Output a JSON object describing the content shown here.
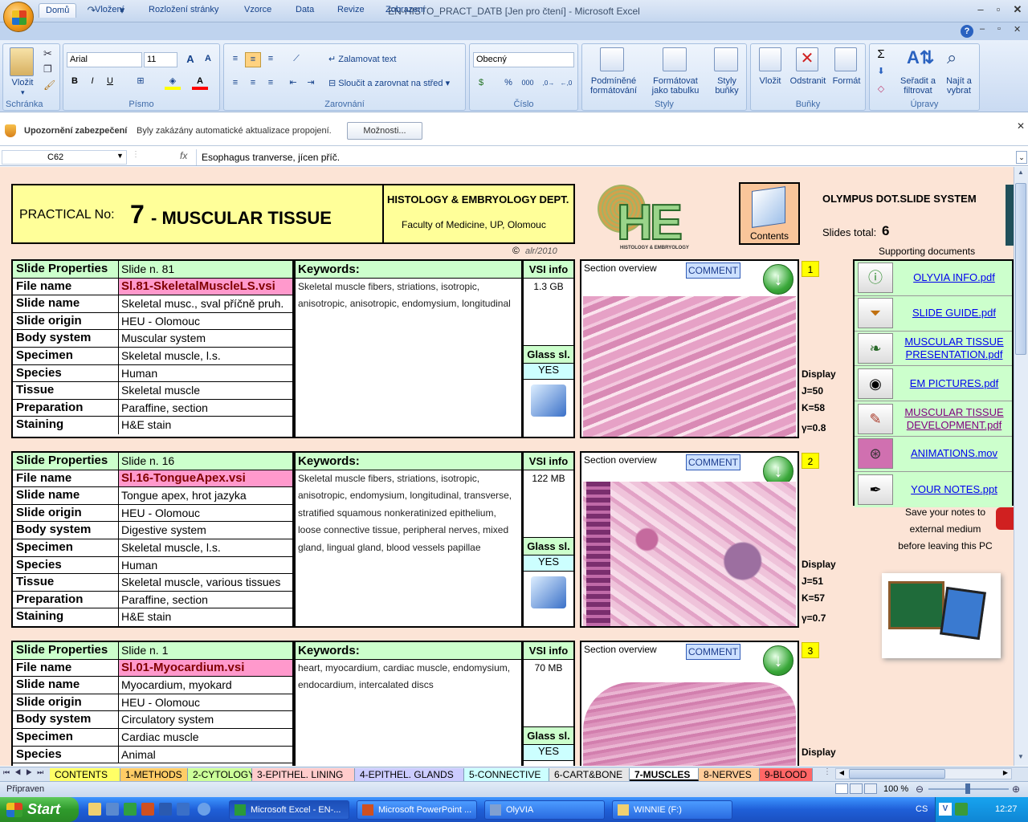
{
  "window": {
    "title": "EN-HISTO_PRACT_DATB  [Jen pro čtení] - Microsoft Excel"
  },
  "ribbon": {
    "tabs": [
      "Domů",
      "Vložení",
      "Rozložení stránky",
      "Vzorce",
      "Data",
      "Revize",
      "Zobrazení"
    ],
    "groups": {
      "clipboard": {
        "label": "Schránka",
        "paste": "Vložit"
      },
      "font": {
        "label": "Písmo",
        "font_name": "Arial",
        "font_size": "11"
      },
      "alignment": {
        "label": "Zarovnání",
        "wrap": "Zalamovat text",
        "merge": "Sloučit a zarovnat na střed"
      },
      "number": {
        "label": "Číslo",
        "format": "Obecný"
      },
      "styles": {
        "label": "Styly",
        "cond1": "Podmíněné",
        "cond2": "formátování",
        "table1": "Formátovat",
        "table2": "jako tabulku",
        "cell1": "Styly",
        "cell2": "buňky"
      },
      "cells": {
        "label": "Buňky",
        "insert": "Vložit",
        "delete": "Odstranit",
        "format": "Formát"
      },
      "editing": {
        "label": "Úpravy",
        "sort1": "Seřadit a",
        "sort2": "filtrovat",
        "find1": "Najít a",
        "find2": "vybrat"
      }
    }
  },
  "security_bar": {
    "title": "Upozornění zabezpečení",
    "message": "Byly zakázány automatické aktualizace propojení.",
    "button": "Možnosti..."
  },
  "formula_bar": {
    "cell": "C62",
    "fx": "fx",
    "value": "Esophagus tranverse, jícen příč."
  },
  "banner": {
    "practical_label": "PRACTICAL No:",
    "number": "7",
    "title": "- MUSCULAR TISSUE",
    "dept": "HISTOLOGY & EMBRYOLOGY DEPT.",
    "faculty": "Faculty of Medicine, UP, Olomouc",
    "copyright": "©",
    "copyright_sig": "alr/2010",
    "logo_text": "HE",
    "logo_sub": "HISTOLOGY & EMBRYOLOGY",
    "contents": "Contents",
    "system": "OLYMPUS DOT.SLIDE SYSTEM",
    "slides_total_label": "Slides total:",
    "slides_total": "6",
    "supporting": "Supporting documents"
  },
  "labels": {
    "keywords": "Keywords:",
    "vsi_info": "VSI info",
    "glass": "Glass sl.",
    "section_overview": "Section overview",
    "comment": "COMMENT",
    "display": "Display",
    "prop_keys": [
      "Slide Properties",
      "File name",
      "Slide name",
      "Slide origin",
      "Body system",
      "Specimen",
      "Species",
      "Tissue",
      "Preparation",
      "Staining"
    ]
  },
  "slides": [
    {
      "index": "1",
      "slide_no": "Slide n. 81",
      "file": "Sl.81-SkeletalMuscleLS.vsi",
      "name": "Skeletal musc., sval příčně pruh.",
      "origin": "HEU - Olomouc",
      "body": "Muscular system",
      "specimen": "Skeletal muscle, l.s.",
      "species": "Human",
      "tissue": "Skeletal muscle",
      "prep": "Paraffine, section",
      "stain": "H&E stain",
      "keywords": "Skeletal muscle fibers,  striations,  isotropic,  anisotropic,  anisotropic,  endomysium,   longitudinal",
      "size": "1.3 GB",
      "glass": "YES",
      "j": "J=50",
      "k": "K=58",
      "g": "γ=0.8"
    },
    {
      "index": "2",
      "slide_no": "Slide n. 16",
      "file": "Sl.16-TongueApex.vsi",
      "name": "Tongue apex, hrot jazyka",
      "origin": "HEU - Olomouc",
      "body": "Digestive system",
      "specimen": "Skeletal muscle, l.s.",
      "species": "Human",
      "tissue": "Skeletal muscle, various tissues",
      "prep": "Paraffine, section",
      "stain": "H&E stain",
      "keywords": "Skeletal muscle fibers,  striations,  isotropic,  anisotropic,  endomysium,   longitudinal,  transverse,  stratified squamous nonkeratinized  epithelium,  loose connective tissue,  peripheral  nerves,  mixed gland,  lingual gland,  blood vessels  papillae",
      "size": "122 MB",
      "glass": "YES",
      "j": "J=51",
      "k": "K=57",
      "g": "γ=0.7"
    },
    {
      "index": "3",
      "slide_no": "Slide n. 1",
      "file": "Sl.01-Myocardium.vsi",
      "name": "Myocardium, myokard",
      "origin": "HEU - Olomouc",
      "body": "Circulatory system",
      "specimen": "Cardiac muscle",
      "species": "Animal",
      "keywords": "heart,  myocardium,  cardiac muscle,  endomysium,  endocardium,  intercalated discs",
      "size": "70 MB",
      "glass": "YES"
    }
  ],
  "documents": [
    {
      "name": "OLYVIA INFO.pdf",
      "icon": "info-icon"
    },
    {
      "name": "SLIDE GUIDE.pdf",
      "icon": "filter-icon"
    },
    {
      "name": "MUSCULAR TISSUE PRESENTATION.pdf",
      "icon": "presentation-icon"
    },
    {
      "name": "EM PICTURES.pdf",
      "icon": "camera-icon"
    },
    {
      "name": "MUSCULAR TISSUE DEVELOPMENT.pdf",
      "icon": "document-icon"
    },
    {
      "name": "ANIMATIONS.mov",
      "icon": "film-icon"
    },
    {
      "name": "YOUR NOTES.ppt",
      "icon": "pen-icon"
    }
  ],
  "save_note": [
    "Save your notes to",
    "external medium",
    "before leaving this PC"
  ],
  "sheet_tabs": [
    {
      "label": "CONTENTS",
      "color": "#ffff66"
    },
    {
      "label": "1-METHODS",
      "color": "#ffcc66"
    },
    {
      "label": "2-CYTOLOGY",
      "color": "#ccff99"
    },
    {
      "label": "3-EPITHEL. LINING",
      "color": "#ffcccc"
    },
    {
      "label": "4-EPITHEL. GLANDS",
      "color": "#ccccff"
    },
    {
      "label": "5-CONNECTIVE",
      "color": "#ccffff"
    },
    {
      "label": "6-CART&BONE",
      "color": "#e6e6e6"
    },
    {
      "label": "7-MUSCLES",
      "color": "#ffffff",
      "active": true
    },
    {
      "label": "8-NERVES",
      "color": "#ffcc99"
    },
    {
      "label": "9-BLOOD",
      "color": "#ff6666"
    }
  ],
  "status": {
    "text": "Připraven",
    "zoom": "100 %"
  },
  "taskbar": {
    "start": "Start",
    "tasks": [
      "Microsoft Excel - EN-...",
      "Microsoft PowerPoint ...",
      "OlyVIA",
      "WINNIE (F:)"
    ],
    "lang": "CS",
    "time": "12:27"
  }
}
